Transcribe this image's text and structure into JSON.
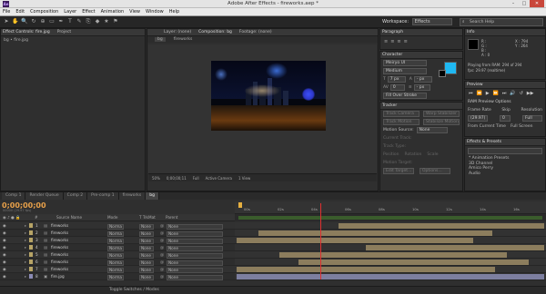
{
  "window": {
    "title": "Adobe After Effects - fireworks.aep *",
    "min": "–",
    "max": "□",
    "close": "✕"
  },
  "menu": [
    "File",
    "Edit",
    "Composition",
    "Layer",
    "Effect",
    "Animation",
    "View",
    "Window",
    "Help"
  ],
  "toolbar": {
    "tools": [
      "➤",
      "✋",
      "🔍",
      "↻",
      "⊕",
      "▭",
      "✒",
      "T",
      "✎",
      "⎘",
      "◆",
      "★",
      "⚑"
    ],
    "workspace_label": "Workspace:",
    "workspace_value": "Effects",
    "search_placeholder": "Search Help"
  },
  "left_panel": {
    "tabs": [
      "Effect Controls: fire.jpg",
      "Project"
    ],
    "subtitle": "bg • fire.jpg"
  },
  "viewer_panel": {
    "tabs": [
      "Layer: (none)",
      "Composition: bg",
      "Footage: (none)"
    ],
    "breadcrumb": [
      "bg",
      "fireworks"
    ],
    "controls": [
      "50%",
      "0;00;00;11",
      "Full",
      "Active Camera",
      "1 View"
    ]
  },
  "paragraph": {
    "tab": "Paragraph"
  },
  "character": {
    "tab": "Character",
    "font": "Meiryo UI",
    "style": "Medium",
    "size": "7 px",
    "leading": "- px",
    "tracking": "0",
    "stroke": "- px",
    "stroke_style": "Fill Over Stroke",
    "fill_color": "#1fb8f2",
    "stroke_color": "#000000"
  },
  "tracker": {
    "tab": "Tracker",
    "buttons": [
      "Track Camera",
      "Warp Stabilizer",
      "Track Motion",
      "Stabilize Motion"
    ],
    "motion_source_label": "Motion Source:",
    "motion_source": "None",
    "rows": [
      "Current Track:",
      "Track Type:",
      "Position",
      "Rotation",
      "Scale",
      "Motion Target:",
      "Edit Target...",
      "Options..."
    ]
  },
  "info": {
    "tab": "Info",
    "r": "R :",
    "g": "G :",
    "b": "B :",
    "a": "A : 0",
    "x": "X : 794",
    "y": "Y : 264",
    "status1": "Playing from RAM: 294 of 294",
    "status2": "fps: 29.97 (realtime)"
  },
  "preview": {
    "tab": "Preview",
    "ram_options": "RAM Preview Options",
    "headers": [
      "Frame Rate",
      "Skip",
      "Resolution"
    ],
    "values": [
      "(29.97)",
      "0",
      "Full"
    ],
    "checks": [
      "From Current Time",
      "Full Screen"
    ]
  },
  "effects": {
    "tab": "Effects & Presets",
    "search_value": "",
    "items": [
      "* Animation Presets",
      "3D Channel",
      "Amico Perry",
      "Audio"
    ]
  },
  "comp_tabs": [
    "Comp 1",
    "Render Queue",
    "Comp 2",
    "Pre-comp 1",
    "fireworks",
    "bg"
  ],
  "timeline": {
    "timecode": "0;00;00;00",
    "timecode_sub": "00000 (29.97 fps)",
    "headers": [
      "#",
      "Source Name",
      "Mode",
      "T TrkMat",
      "Parent"
    ],
    "ruler": [
      "00s",
      "02s",
      "04s",
      "06s",
      "08s",
      "10s",
      "12s",
      "14s",
      "16s",
      "18s"
    ],
    "layers": [
      {
        "num": "1",
        "name": "fireworks",
        "mode": "Norma",
        "trk": "None",
        "parent": "None",
        "start": 0.33,
        "end": 1.0
      },
      {
        "num": "2",
        "name": "fireworks",
        "mode": "Norma",
        "trk": "None",
        "parent": "None",
        "start": 0.07,
        "end": 0.83
      },
      {
        "num": "3",
        "name": "fireworks",
        "mode": "Norma",
        "trk": "None",
        "parent": "None",
        "start": 0.0,
        "end": 0.77
      },
      {
        "num": "4",
        "name": "fireworks",
        "mode": "Norma",
        "trk": "None",
        "parent": "None",
        "start": 0.42,
        "end": 1.0
      },
      {
        "num": "5",
        "name": "fireworks",
        "mode": "Norma",
        "trk": "None",
        "parent": "None",
        "start": 0.14,
        "end": 0.88
      },
      {
        "num": "6",
        "name": "fireworks",
        "mode": "Norma",
        "trk": "None",
        "parent": "None",
        "start": 0.2,
        "end": 0.95
      },
      {
        "num": "7",
        "name": "fireworks",
        "mode": "Norma",
        "trk": "None",
        "parent": "None",
        "start": 0.0,
        "end": 0.84
      },
      {
        "num": "8",
        "name": "fire.jpg",
        "mode": "Norma",
        "trk": "None",
        "parent": "None",
        "start": 0.0,
        "end": 1.0
      }
    ],
    "layer_color": "#8c7d5d",
    "image_layer_color": "#7d7fa0",
    "toggle_label": "Toggle Switches / Modes"
  }
}
